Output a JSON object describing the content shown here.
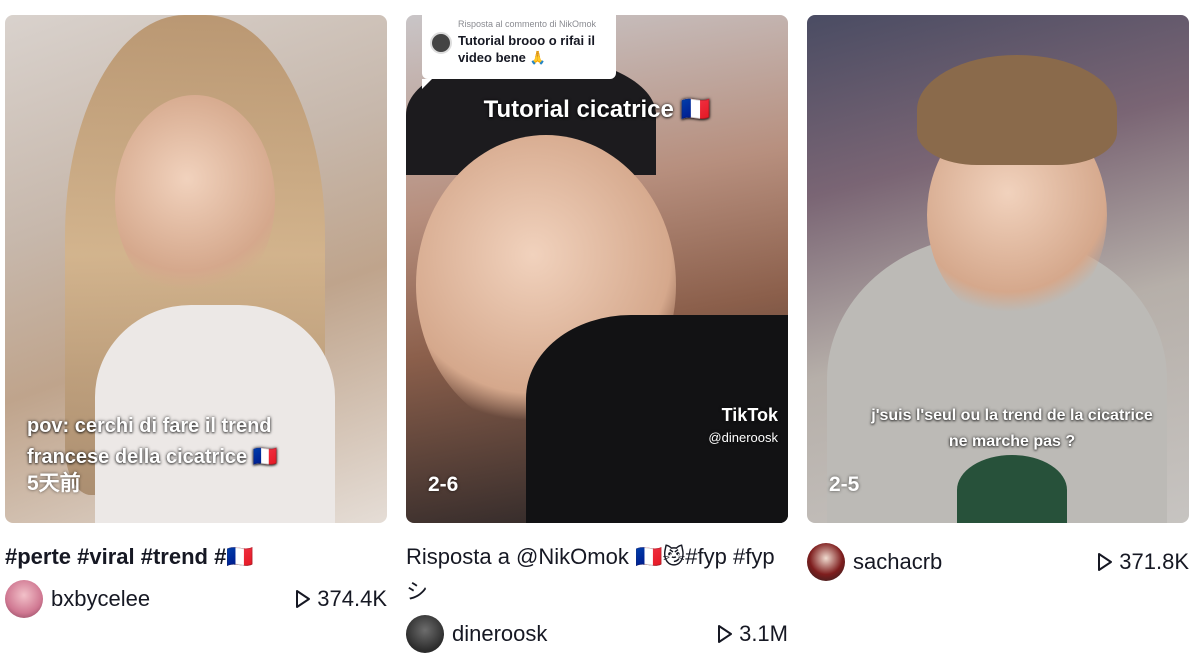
{
  "videos": [
    {
      "caption": "pov: cerchi di fare il trend francese della cicatrice 🇫🇷",
      "date": "5天前",
      "description": "#perte #viral #trend #🇫🇷",
      "username": "bxbycelee",
      "views": "374.4K",
      "play_icon": "play-icon"
    },
    {
      "reply_header": "Risposta al commento di NikOmok",
      "reply_text": "Tutorial brooo o rifai il video bene 🙏",
      "title": "Tutorial cicatrice 🇫🇷",
      "watermark_logo": "TikTok",
      "watermark_user": "@dineroosk",
      "date": "2-6",
      "description": "Risposta a @NikOmok 🇫🇷😼#fyp #fypシ",
      "username": "dineroosk",
      "views": "3.1M",
      "play_icon": "play-icon"
    },
    {
      "caption": "j'suis l'seul ou la trend de la cicatrice ne marche pas ?",
      "date": "2-5",
      "username": "sachacrb",
      "views": "371.8K",
      "play_icon": "play-icon"
    }
  ]
}
